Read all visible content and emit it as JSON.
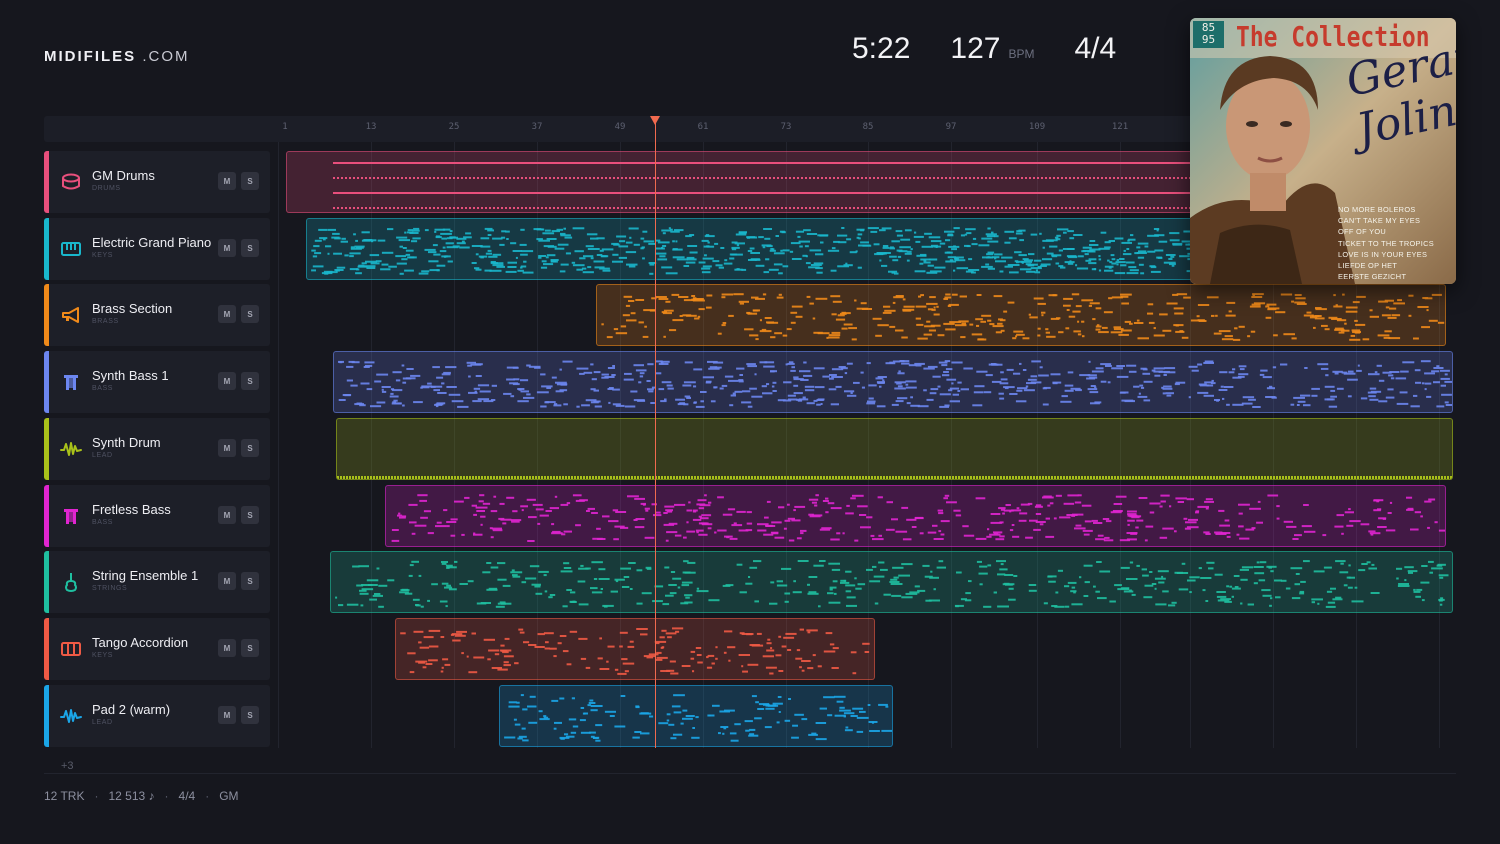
{
  "brand": {
    "name_bold": "MIDIFILES",
    "name_domain": " .COM"
  },
  "transport": {
    "time": "5:22",
    "tempo": "127",
    "tempo_unit": "BPM",
    "time_signature": "4/4"
  },
  "ruler": {
    "marks": [
      "1",
      "13",
      "25",
      "37",
      "49",
      "61",
      "73",
      "85",
      "97",
      "109",
      "121"
    ]
  },
  "tracks": [
    {
      "name": "GM Drums",
      "category": "DRUMS",
      "color": "#e84f7c",
      "icon": "drum-icon"
    },
    {
      "name": "Electric Grand Piano",
      "category": "KEYS",
      "color": "#19b7cc",
      "icon": "piano-icon"
    },
    {
      "name": "Brass Section",
      "category": "BRASS",
      "color": "#f08a1a",
      "icon": "trumpet-icon"
    },
    {
      "name": "Synth Bass 1",
      "category": "BASS",
      "color": "#6c86f0",
      "icon": "bass-icon"
    },
    {
      "name": "Synth Drum",
      "category": "LEAD",
      "color": "#a9c11a",
      "icon": "waveform-icon"
    },
    {
      "name": "Fretless Bass",
      "category": "BASS",
      "color": "#e025d0",
      "icon": "bass-icon"
    },
    {
      "name": "String Ensemble 1",
      "category": "STRINGS",
      "color": "#1fbfa0",
      "icon": "violin-icon"
    },
    {
      "name": "Tango Accordion",
      "category": "KEYS",
      "color": "#ef5a45",
      "icon": "accordion-icon"
    },
    {
      "name": "Pad 2 (warm)",
      "category": "LEAD",
      "color": "#1ba6e8",
      "icon": "waveform-icon"
    }
  ],
  "mute_label": "M",
  "solo_label": "S",
  "more_tracks": "+3",
  "footer": {
    "tracks": "12 TRK",
    "notes": "12 513 ♪",
    "time_signature": "4/4",
    "standard": "GM"
  },
  "album": {
    "badge": "85 95",
    "title": "The Collection",
    "artist": "Gerard Joling",
    "songs": [
      "NO MORE BOLEROS",
      "CAN'T TAKE MY EYES",
      "OFF OF YOU",
      "TICKET TO THE TROPICS",
      "LOVE IS IN YOUR EYES",
      "LIEFDE OP HET",
      "EERSTE GEZICHT"
    ]
  }
}
